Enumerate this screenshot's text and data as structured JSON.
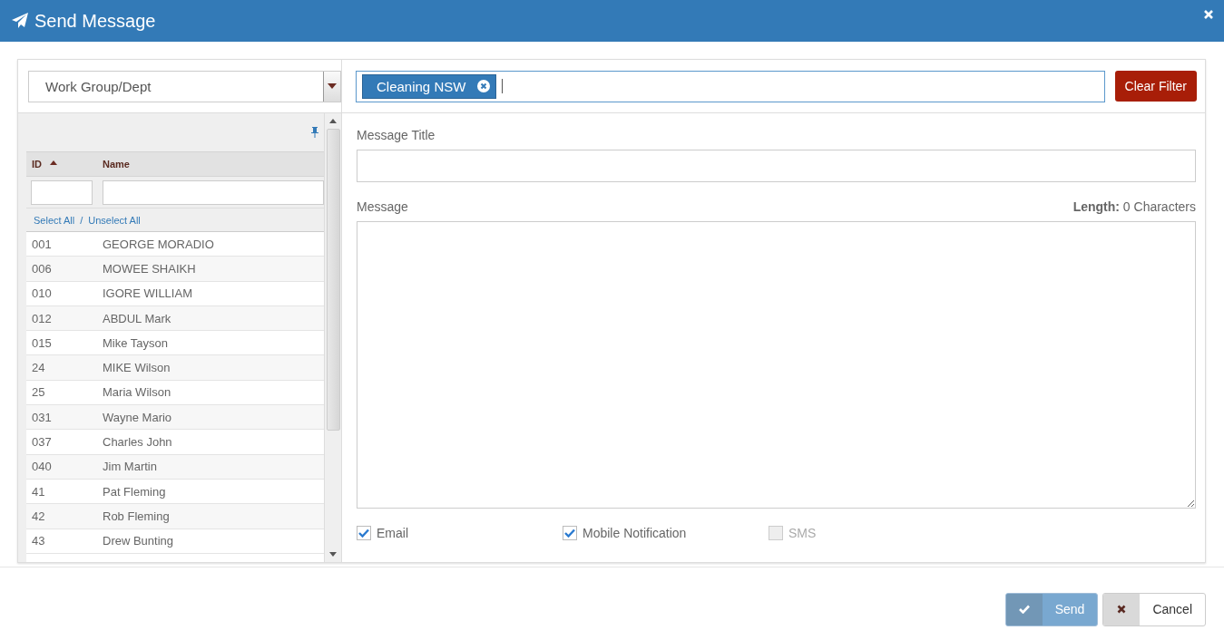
{
  "window": {
    "title": "Send Message"
  },
  "group_select": {
    "value": "Work Group/Dept"
  },
  "filter": {
    "tags": [
      {
        "label": "Cleaning NSW"
      }
    ]
  },
  "clear_filter_button": "Clear Filter",
  "grid": {
    "columns": [
      {
        "label": "ID",
        "sorted": true
      },
      {
        "label": "Name",
        "sorted": false
      }
    ],
    "select_all": "Select All",
    "separator": "/",
    "unselect_all": "Unselect All",
    "rows": [
      {
        "id": "001",
        "name": "GEORGE MORADIO"
      },
      {
        "id": "006",
        "name": "MOWEE SHAIKH"
      },
      {
        "id": "010",
        "name": "IGORE WILLIAM"
      },
      {
        "id": "012",
        "name": "ABDUL Mark"
      },
      {
        "id": "015",
        "name": "Mike Tayson"
      },
      {
        "id": "24",
        "name": "MIKE Wilson"
      },
      {
        "id": "25",
        "name": "Maria Wilson"
      },
      {
        "id": "031",
        "name": "Wayne Mario"
      },
      {
        "id": "037",
        "name": "Charles John"
      },
      {
        "id": "040",
        "name": "Jim Martin"
      },
      {
        "id": "41",
        "name": "Pat Fleming"
      },
      {
        "id": "42",
        "name": "Rob Fleming"
      },
      {
        "id": "43",
        "name": "Drew Bunting"
      }
    ]
  },
  "message_title": {
    "label": "Message Title"
  },
  "message": {
    "label": "Message",
    "length_label": "Length:",
    "length_value": "0 Characters"
  },
  "channels": [
    {
      "label": "Email",
      "checked": true,
      "disabled": false
    },
    {
      "label": "Mobile Notification",
      "checked": true,
      "disabled": false
    },
    {
      "label": "SMS",
      "checked": false,
      "disabled": true
    }
  ],
  "buttons": [
    {
      "kind": "send",
      "label": "Send",
      "disabled": true
    },
    {
      "kind": "cancel",
      "label": "Cancel",
      "disabled": false
    }
  ]
}
